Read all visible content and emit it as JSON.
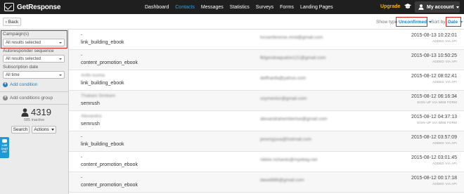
{
  "app": {
    "logo_text": "GetResponse",
    "accent": "#2ea3e0",
    "upgrade_color": "#f3b500",
    "highlight_color": "#e0201b"
  },
  "nav": {
    "items": [
      "Dashboard",
      "Contacts",
      "Messages",
      "Statistics",
      "Surveys",
      "Forms",
      "Landing Pages"
    ],
    "active": "Contacts"
  },
  "header_right": {
    "upgrade_label": "Upgrade",
    "cap_icon": "graduation-cap-icon",
    "account_label": "My account"
  },
  "toolbar": {
    "back_label": "‹ Back",
    "show_type_label": "Show type",
    "show_type_value": "Unconfirmed",
    "sort_label": "Sort by",
    "sort_value": "Date"
  },
  "sidebar": {
    "campaign_label": "Campaign(s)",
    "campaign_value": "All results selected",
    "autoresponder_label": "Autoresponder sequence",
    "autoresponder_value": "All results selected",
    "subscription_label": "Subscription date",
    "subscription_value": "All time",
    "add_condition_label": "Add condition",
    "add_group_label": "Add conditions group",
    "count": "4319",
    "inactive_label": "585 inactive",
    "search_label": "Search",
    "actions_label": "Actions",
    "live_chat_top": "LIVE",
    "live_chat_mid": "CHAT",
    "live_chat_bot": "24/7"
  },
  "contacts": [
    {
      "name": "-",
      "campaign": "link_building_ebook",
      "email": "lvcsenfererse.mnd@gmail.com",
      "date": "2015-08-13 10:22:01",
      "via": "ADDED VIA API"
    },
    {
      "name": "-",
      "campaign": "content_promotion_ebook",
      "email": "fkfgendraqualze121@gmail.com",
      "date": "2015-08-13 10:50:25",
      "via": "ADDED VIA API"
    },
    {
      "name": "Anfin kumia",
      "campaign": "link_building_ebook",
      "email": "delfhanfa@yahoo.com",
      "date": "2015-08-12 08:02:41",
      "via": "ADDED VIA API"
    },
    {
      "name": "Thabani Simbani",
      "campaign": "semrush",
      "email": "szymentor@gmail.com",
      "date": "2015-08-12 06:16:34",
      "via": "SIGN-UP VIA WEB FORM"
    },
    {
      "name": "Alexandra",
      "campaign": "semrush",
      "email": "alexandrahembertse@gmail.com",
      "date": "2015-08-12 04:37:13",
      "via": "SIGN-UP VIA WEB FORM"
    },
    {
      "name": "-",
      "campaign": "link_building_ebook",
      "email": "jeremyjuva@hotmail.com",
      "date": "2015-08-12 03:57:09",
      "via": "ADDED VIA API"
    },
    {
      "name": "-",
      "campaign": "content_promotion_ebook",
      "email": "nikkie.richards@myebay.net",
      "date": "2015-08-12 03:01:45",
      "via": "ADDED VIA API"
    },
    {
      "name": "-",
      "campaign": "content_promotion_ebook",
      "email": "dasel886@gmail.com",
      "date": "2015-08-12 00:17:18",
      "via": "ADDED VIA API"
    }
  ]
}
